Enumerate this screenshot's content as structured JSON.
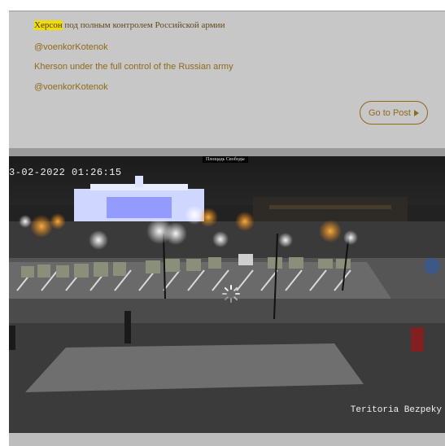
{
  "post": {
    "ru_highlight": "Херсон",
    "ru_rest": " под полным контролем Российской армии",
    "author_1": "@voenkorKotenok",
    "en_text": "Kherson under the full control of the Russian army",
    "author_2": "@voenkorKotenok",
    "goto_label": "Go to Post"
  },
  "camera": {
    "location_label": "Площадь Свободы",
    "timestamp": "3-02-2022 01:26:15",
    "watermark": "Teritoria Bezpeky"
  },
  "colors": {
    "accent": "#8f6a1c",
    "highlight": "#f2dd00",
    "card_bg": "#c7c7c7"
  },
  "icons": {
    "goto": "play-triangle-icon",
    "loading": "loading-spinner-icon"
  }
}
